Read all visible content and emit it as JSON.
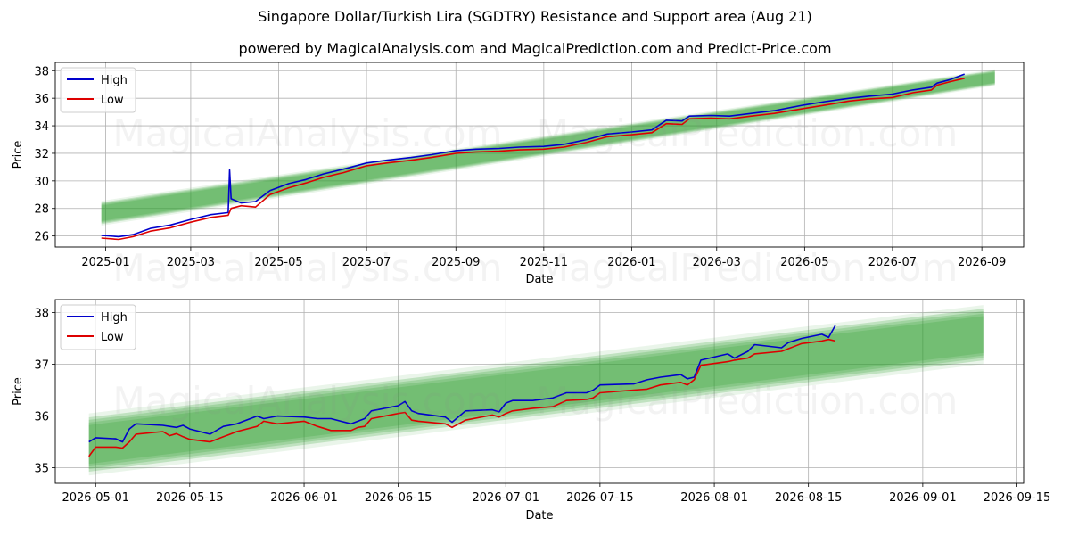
{
  "figure": {
    "title": "Singapore Dollar/Turkish Lira (SGDTRY) Resistance and Support area (Aug 21)",
    "subtitle": "powered by MagicalAnalysis.com and MagicalPrediction.com and Predict-Price.com",
    "watermarks": [
      "MagicalAnalysis.com",
      "MagicalPrediction.com"
    ],
    "colors": {
      "high": "#0000cc",
      "low": "#dd0000",
      "band": "#2e9e2e",
      "grid": "#b0b0b0"
    }
  },
  "chart_data": [
    {
      "type": "line",
      "xlabel": "Date",
      "ylabel": "Price",
      "ylim": [
        25.2,
        38.6
      ],
      "yticks": [
        26,
        28,
        30,
        32,
        34,
        36,
        38
      ],
      "xticks": [
        "2025-01",
        "2025-03",
        "2025-05",
        "2025-07",
        "2025-09",
        "2025-11",
        "2026-01",
        "2026-03",
        "2026-05",
        "2026-07",
        "2026-09"
      ],
      "legend": "upper-left",
      "grid": true,
      "series": [
        {
          "name": "High",
          "points": [
            [
              "2024-12-29",
              26.05
            ],
            [
              "2025-01-10",
              25.95
            ],
            [
              "2025-01-20",
              26.1
            ],
            [
              "2025-02-01",
              26.55
            ],
            [
              "2025-02-15",
              26.8
            ],
            [
              "2025-03-01",
              27.2
            ],
            [
              "2025-03-15",
              27.55
            ],
            [
              "2025-03-27",
              27.7
            ],
            [
              "2025-03-28",
              30.8
            ],
            [
              "2025-03-29",
              28.7
            ],
            [
              "2025-04-05",
              28.4
            ],
            [
              "2025-04-15",
              28.5
            ],
            [
              "2025-04-25",
              29.3
            ],
            [
              "2025-05-08",
              29.8
            ],
            [
              "2025-05-20",
              30.1
            ],
            [
              "2025-06-01",
              30.5
            ],
            [
              "2025-06-15",
              30.85
            ],
            [
              "2025-07-01",
              31.3
            ],
            [
              "2025-07-15",
              31.5
            ],
            [
              "2025-08-01",
              31.7
            ],
            [
              "2025-08-15",
              31.9
            ],
            [
              "2025-09-01",
              32.2
            ],
            [
              "2025-09-15",
              32.3
            ],
            [
              "2025-10-01",
              32.35
            ],
            [
              "2025-10-15",
              32.45
            ],
            [
              "2025-11-01",
              32.5
            ],
            [
              "2025-11-15",
              32.65
            ],
            [
              "2025-12-01",
              33.0
            ],
            [
              "2025-12-15",
              33.4
            ],
            [
              "2026-01-01",
              33.55
            ],
            [
              "2026-01-15",
              33.7
            ],
            [
              "2026-01-25",
              34.4
            ],
            [
              "2026-02-05",
              34.35
            ],
            [
              "2026-02-10",
              34.7
            ],
            [
              "2026-02-25",
              34.75
            ],
            [
              "2026-03-10",
              34.7
            ],
            [
              "2026-03-25",
              34.9
            ],
            [
              "2026-04-10",
              35.1
            ],
            [
              "2026-04-30",
              35.5
            ],
            [
              "2026-05-15",
              35.75
            ],
            [
              "2026-06-01",
              36.0
            ],
            [
              "2026-06-15",
              36.15
            ],
            [
              "2026-07-01",
              36.3
            ],
            [
              "2026-07-15",
              36.6
            ],
            [
              "2026-07-28",
              36.8
            ],
            [
              "2026-08-01",
              37.1
            ],
            [
              "2026-08-10",
              37.35
            ],
            [
              "2026-08-20",
              37.75
            ]
          ]
        },
        {
          "name": "Low",
          "points": [
            [
              "2024-12-29",
              25.85
            ],
            [
              "2025-01-10",
              25.75
            ],
            [
              "2025-01-20",
              25.95
            ],
            [
              "2025-02-01",
              26.35
            ],
            [
              "2025-02-15",
              26.6
            ],
            [
              "2025-03-01",
              27.0
            ],
            [
              "2025-03-15",
              27.35
            ],
            [
              "2025-03-27",
              27.5
            ],
            [
              "2025-03-29",
              28.0
            ],
            [
              "2025-04-05",
              28.2
            ],
            [
              "2025-04-15",
              28.1
            ],
            [
              "2025-04-25",
              29.0
            ],
            [
              "2025-05-08",
              29.5
            ],
            [
              "2025-05-20",
              29.85
            ],
            [
              "2025-06-01",
              30.25
            ],
            [
              "2025-06-15",
              30.6
            ],
            [
              "2025-07-01",
              31.1
            ],
            [
              "2025-07-15",
              31.3
            ],
            [
              "2025-08-01",
              31.5
            ],
            [
              "2025-08-15",
              31.7
            ],
            [
              "2025-09-01",
              32.0
            ],
            [
              "2025-09-15",
              32.1
            ],
            [
              "2025-10-01",
              32.15
            ],
            [
              "2025-10-15",
              32.25
            ],
            [
              "2025-11-01",
              32.3
            ],
            [
              "2025-11-15",
              32.45
            ],
            [
              "2025-12-01",
              32.8
            ],
            [
              "2025-12-15",
              33.2
            ],
            [
              "2026-01-01",
              33.35
            ],
            [
              "2026-01-15",
              33.5
            ],
            [
              "2026-01-25",
              34.15
            ],
            [
              "2026-02-05",
              34.1
            ],
            [
              "2026-02-10",
              34.5
            ],
            [
              "2026-02-25",
              34.55
            ],
            [
              "2026-03-10",
              34.5
            ],
            [
              "2026-03-25",
              34.7
            ],
            [
              "2026-04-10",
              34.9
            ],
            [
              "2026-04-30",
              35.25
            ],
            [
              "2026-05-15",
              35.5
            ],
            [
              "2026-06-01",
              35.8
            ],
            [
              "2026-06-15",
              35.95
            ],
            [
              "2026-07-01",
              36.05
            ],
            [
              "2026-07-15",
              36.4
            ],
            [
              "2026-07-28",
              36.6
            ],
            [
              "2026-08-01",
              36.95
            ],
            [
              "2026-08-10",
              37.2
            ],
            [
              "2026-08-20",
              37.45
            ]
          ]
        }
      ],
      "band": {
        "start": "2024-12-29",
        "end": "2026-09-10",
        "upper": [
          28.4,
          38.0
        ],
        "lower": [
          26.9,
          37.0
        ]
      }
    },
    {
      "type": "line",
      "xlabel": "Date",
      "ylabel": "Price",
      "ylim": [
        34.7,
        38.25
      ],
      "yticks": [
        35,
        36,
        37,
        38
      ],
      "xticks": [
        "2026-05-01",
        "2026-05-15",
        "2026-06-01",
        "2026-06-15",
        "2026-07-01",
        "2026-07-15",
        "2026-08-01",
        "2026-08-15",
        "2026-09-01",
        "2026-09-15"
      ],
      "legend": "upper-left",
      "grid": true,
      "series": [
        {
          "name": "High",
          "points": [
            [
              "2026-04-30",
              35.5
            ],
            [
              "2026-05-01",
              35.58
            ],
            [
              "2026-05-04",
              35.56
            ],
            [
              "2026-05-05",
              35.5
            ],
            [
              "2026-05-06",
              35.75
            ],
            [
              "2026-05-07",
              35.85
            ],
            [
              "2026-05-11",
              35.82
            ],
            [
              "2026-05-12",
              35.8
            ],
            [
              "2026-05-13",
              35.78
            ],
            [
              "2026-05-14",
              35.82
            ],
            [
              "2026-05-15",
              35.75
            ],
            [
              "2026-05-18",
              35.65
            ],
            [
              "2026-05-20",
              35.8
            ],
            [
              "2026-05-22",
              35.85
            ],
            [
              "2026-05-25",
              36.0
            ],
            [
              "2026-05-26",
              35.95
            ],
            [
              "2026-05-28",
              36.0
            ],
            [
              "2026-06-01",
              35.98
            ],
            [
              "2026-06-03",
              35.95
            ],
            [
              "2026-06-05",
              35.95
            ],
            [
              "2026-06-08",
              35.85
            ],
            [
              "2026-06-09",
              35.9
            ],
            [
              "2026-06-10",
              35.95
            ],
            [
              "2026-06-11",
              36.1
            ],
            [
              "2026-06-15",
              36.2
            ],
            [
              "2026-06-16",
              36.28
            ],
            [
              "2026-06-17",
              36.1
            ],
            [
              "2026-06-18",
              36.05
            ],
            [
              "2026-06-22",
              35.98
            ],
            [
              "2026-06-23",
              35.88
            ],
            [
              "2026-06-25",
              36.1
            ],
            [
              "2026-06-29",
              36.12
            ],
            [
              "2026-06-30",
              36.08
            ],
            [
              "2026-07-01",
              36.25
            ],
            [
              "2026-07-02",
              36.3
            ],
            [
              "2026-07-05",
              36.3
            ],
            [
              "2026-07-08",
              36.35
            ],
            [
              "2026-07-10",
              36.45
            ],
            [
              "2026-07-13",
              36.45
            ],
            [
              "2026-07-14",
              36.5
            ],
            [
              "2026-07-15",
              36.6
            ],
            [
              "2026-07-20",
              36.62
            ],
            [
              "2026-07-22",
              36.7
            ],
            [
              "2026-07-24",
              36.75
            ],
            [
              "2026-07-27",
              36.8
            ],
            [
              "2026-07-28",
              36.72
            ],
            [
              "2026-07-29",
              36.75
            ],
            [
              "2026-07-30",
              37.08
            ],
            [
              "2026-08-03",
              37.2
            ],
            [
              "2026-08-04",
              37.12
            ],
            [
              "2026-08-06",
              37.25
            ],
            [
              "2026-08-07",
              37.38
            ],
            [
              "2026-08-11",
              37.32
            ],
            [
              "2026-08-12",
              37.42
            ],
            [
              "2026-08-14",
              37.5
            ],
            [
              "2026-08-17",
              37.58
            ],
            [
              "2026-08-18",
              37.52
            ],
            [
              "2026-08-19",
              37.75
            ]
          ]
        },
        {
          "name": "Low",
          "points": [
            [
              "2026-04-30",
              35.22
            ],
            [
              "2026-05-01",
              35.4
            ],
            [
              "2026-05-04",
              35.4
            ],
            [
              "2026-05-05",
              35.38
            ],
            [
              "2026-05-06",
              35.5
            ],
            [
              "2026-05-07",
              35.65
            ],
            [
              "2026-05-11",
              35.7
            ],
            [
              "2026-05-12",
              35.62
            ],
            [
              "2026-05-13",
              35.66
            ],
            [
              "2026-05-14",
              35.6
            ],
            [
              "2026-05-15",
              35.55
            ],
            [
              "2026-05-18",
              35.5
            ],
            [
              "2026-05-20",
              35.6
            ],
            [
              "2026-05-22",
              35.7
            ],
            [
              "2026-05-25",
              35.8
            ],
            [
              "2026-05-26",
              35.9
            ],
            [
              "2026-05-28",
              35.85
            ],
            [
              "2026-06-01",
              35.9
            ],
            [
              "2026-06-03",
              35.8
            ],
            [
              "2026-06-05",
              35.72
            ],
            [
              "2026-06-08",
              35.72
            ],
            [
              "2026-06-09",
              35.78
            ],
            [
              "2026-06-10",
              35.8
            ],
            [
              "2026-06-11",
              35.95
            ],
            [
              "2026-06-15",
              36.05
            ],
            [
              "2026-06-16",
              36.07
            ],
            [
              "2026-06-17",
              35.92
            ],
            [
              "2026-06-18",
              35.9
            ],
            [
              "2026-06-22",
              35.85
            ],
            [
              "2026-06-23",
              35.78
            ],
            [
              "2026-06-25",
              35.92
            ],
            [
              "2026-06-29",
              36.02
            ],
            [
              "2026-06-30",
              35.98
            ],
            [
              "2026-07-01",
              36.05
            ],
            [
              "2026-07-02",
              36.1
            ],
            [
              "2026-07-05",
              36.15
            ],
            [
              "2026-07-08",
              36.18
            ],
            [
              "2026-07-10",
              36.3
            ],
            [
              "2026-07-13",
              36.32
            ],
            [
              "2026-07-14",
              36.35
            ],
            [
              "2026-07-15",
              36.45
            ],
            [
              "2026-07-20",
              36.5
            ],
            [
              "2026-07-22",
              36.52
            ],
            [
              "2026-07-24",
              36.6
            ],
            [
              "2026-07-27",
              36.65
            ],
            [
              "2026-07-28",
              36.6
            ],
            [
              "2026-07-29",
              36.7
            ],
            [
              "2026-07-30",
              36.98
            ],
            [
              "2026-08-03",
              37.05
            ],
            [
              "2026-08-04",
              37.08
            ],
            [
              "2026-08-06",
              37.12
            ],
            [
              "2026-08-07",
              37.2
            ],
            [
              "2026-08-11",
              37.25
            ],
            [
              "2026-08-12",
              37.3
            ],
            [
              "2026-08-14",
              37.4
            ],
            [
              "2026-08-17",
              37.45
            ],
            [
              "2026-08-18",
              37.48
            ],
            [
              "2026-08-19",
              37.45
            ]
          ]
        }
      ],
      "band": {
        "start": "2026-04-30",
        "end": "2026-09-10",
        "upper": [
          35.95,
          38.05
        ],
        "lower": [
          34.95,
          37.1
        ]
      }
    }
  ]
}
